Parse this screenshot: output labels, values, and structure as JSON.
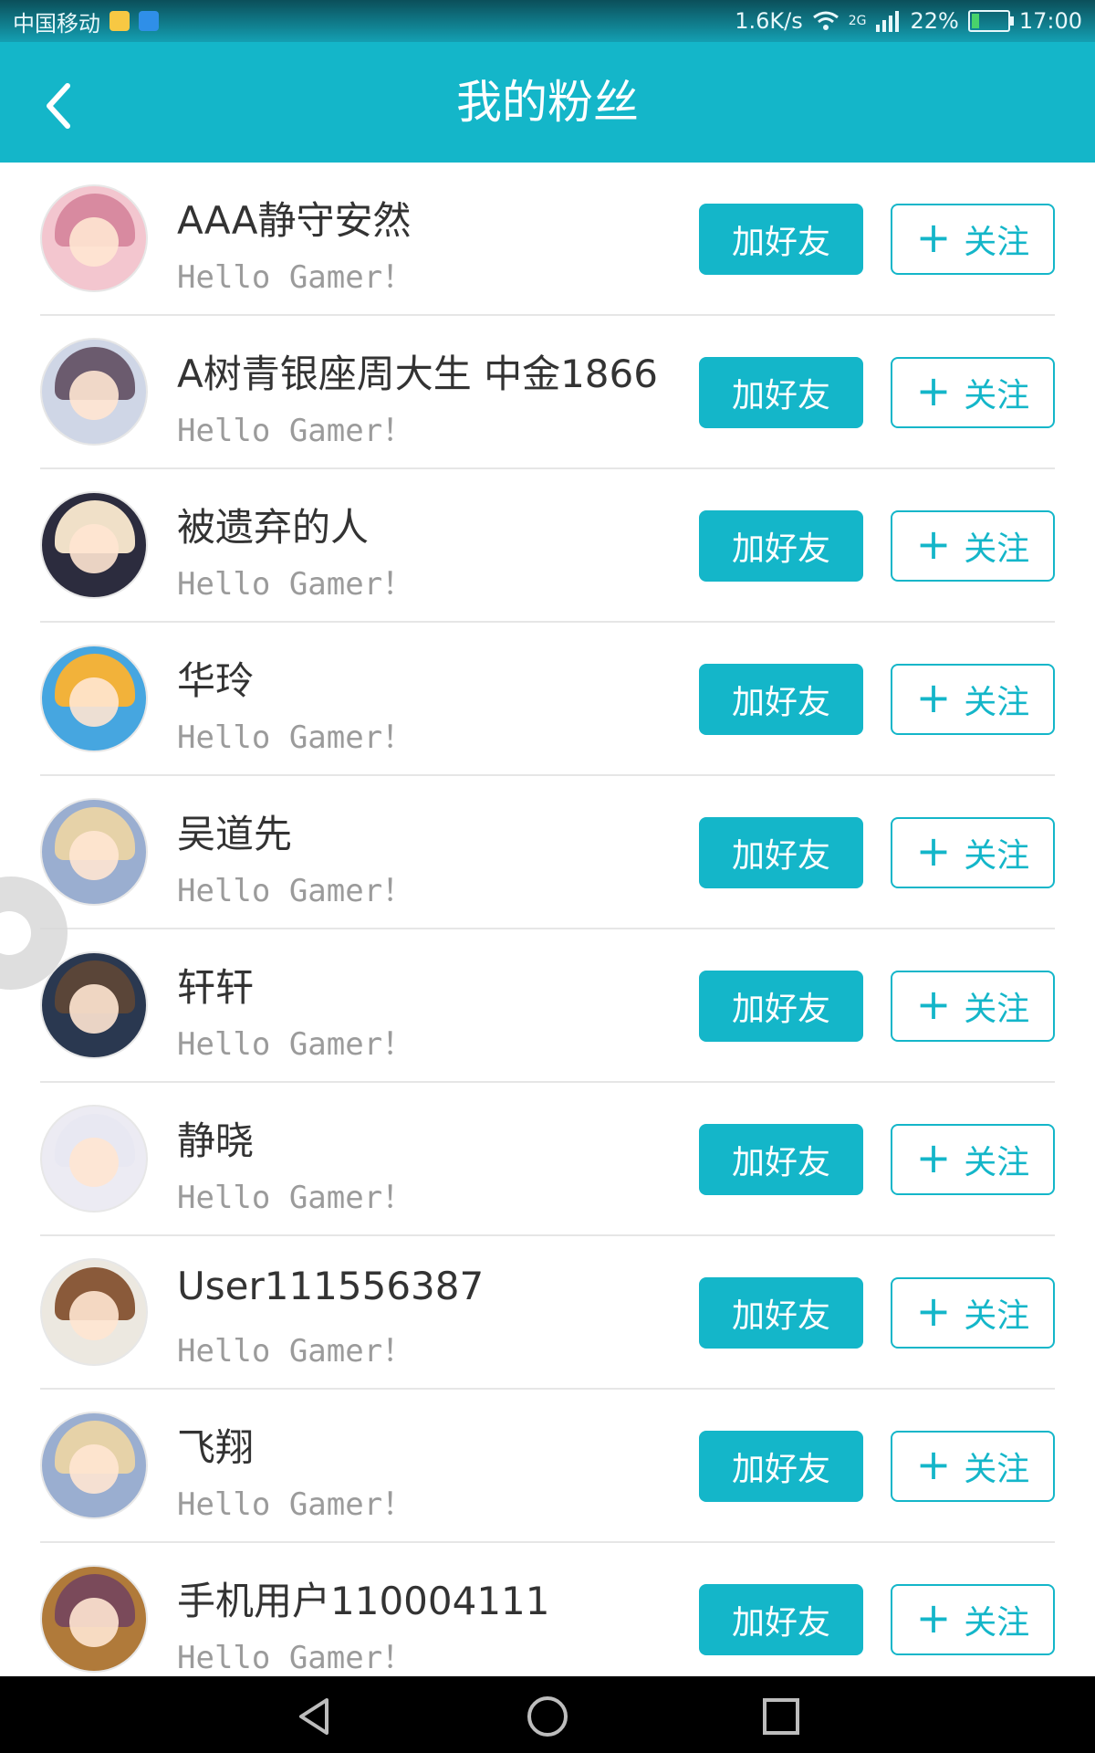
{
  "status": {
    "carrier": "中国移动",
    "speed": "1.6K/s",
    "network": "2G",
    "battery": "22%",
    "battery_level": 0.22,
    "time": "17:00"
  },
  "header": {
    "title": "我的粉丝",
    "back_icon": "chevron-left-icon"
  },
  "list": {
    "add_friend_label": "加好友",
    "follow_label": "关注",
    "follow_icon": "plus-icon",
    "items": [
      {
        "name": "AAA静守安然",
        "subtitle": "Hello Gamer！"
      },
      {
        "name": "A树青银座周大生 中金1866",
        "subtitle": "Hello Gamer！"
      },
      {
        "name": "被遗弃的人",
        "subtitle": "Hello Gamer！"
      },
      {
        "name": "华玲",
        "subtitle": "Hello Gamer！"
      },
      {
        "name": "吴道先",
        "subtitle": "Hello Gamer！"
      },
      {
        "name": "轩轩",
        "subtitle": "Hello Gamer！"
      },
      {
        "name": "静晓",
        "subtitle": "Hello Gamer！"
      },
      {
        "name": "User111556387",
        "subtitle": "Hello Gamer！"
      },
      {
        "name": "飞翔",
        "subtitle": "Hello Gamer！"
      },
      {
        "name": "手机用户110004111",
        "subtitle": "Hello Gamer！"
      }
    ]
  },
  "colors": {
    "accent": "#14b6c9",
    "status_bar": "#0b4f5a",
    "divider": "#e6e6e6"
  },
  "navbar": {
    "back": "triangle-back-icon",
    "home": "circle-home-icon",
    "recents": "square-recents-icon"
  }
}
